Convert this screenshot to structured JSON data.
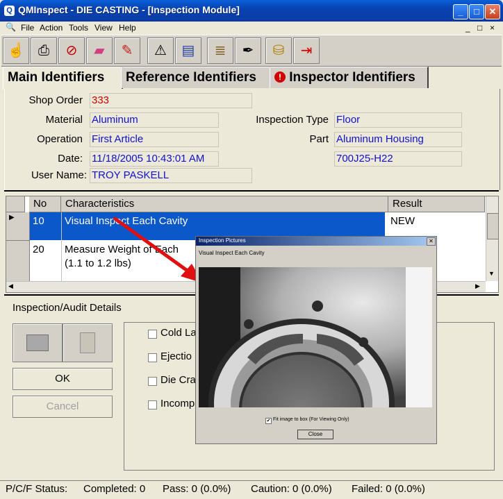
{
  "window": {
    "title": "QMInspect - DIE CASTING - [Inspection Module]",
    "app_icon_glyph": "Q",
    "minimize_glyph": "_",
    "maximize_glyph": "□",
    "close_glyph": "✕"
  },
  "menu": [
    "File",
    "Action",
    "Tools",
    "View",
    "Help"
  ],
  "menu_child_controls": [
    "_",
    "□",
    "×"
  ],
  "toolbar": {
    "buttons": [
      {
        "icon": "hand-icon",
        "glyph": "☝"
      },
      {
        "icon": "printer-icon",
        "glyph": "⎙"
      },
      {
        "icon": "no-entry-icon",
        "glyph": "⊘"
      },
      {
        "icon": "eraser-icon",
        "glyph": "▰"
      },
      {
        "icon": "paint-icon",
        "glyph": "✎"
      },
      {
        "icon": "compass-icon",
        "glyph": "⚠"
      },
      {
        "icon": "book-icon",
        "glyph": "▤"
      },
      {
        "icon": "scroll-icon",
        "glyph": "≣"
      },
      {
        "icon": "signature-icon",
        "glyph": "✒"
      },
      {
        "icon": "coins-icon",
        "glyph": "⛁"
      },
      {
        "icon": "exit-icon",
        "glyph": "⇥"
      }
    ]
  },
  "tabs": [
    {
      "label": "Main Identifiers",
      "active": true
    },
    {
      "label": "Reference Identifiers",
      "active": false
    },
    {
      "label": "Inspector Identifiers",
      "active": false,
      "icon_glyph": "!"
    }
  ],
  "identifiers": {
    "shop_order": {
      "label": "Shop Order",
      "value": "333"
    },
    "material": {
      "label": "Material",
      "value": "Aluminum"
    },
    "operation": {
      "label": "Operation",
      "value": "First Article"
    },
    "date": {
      "label": "Date:",
      "value": "11/18/2005 10:43:01 AM"
    },
    "user_name": {
      "label": "User Name:",
      "value": "TROY PASKELL"
    },
    "inspection_type": {
      "label": "Inspection Type",
      "value": "Floor"
    },
    "part": {
      "label": "Part",
      "value": "Aluminum Housing"
    },
    "part_number": {
      "value": "700J25-H22"
    }
  },
  "grid": {
    "headers": [
      "No",
      "Characteristics",
      "Result"
    ],
    "rows": [
      {
        "no": "10",
        "characteristic": "Visual Inspect Each Cavity",
        "result": "NEW",
        "selected": true
      },
      {
        "no": "20",
        "characteristic_line1": "Measure Weight of Each",
        "characteristic_line2": "(1.1 to 1.2 lbs)",
        "result": ""
      }
    ]
  },
  "details": {
    "title": "Inspection/Audit Details",
    "ok_label": "OK",
    "cancel_label": "Cancel",
    "checks": [
      "Cold La",
      "Ejectio",
      "Die Cra",
      "Incomp"
    ]
  },
  "status": {
    "label": "P/C/F Status:",
    "completed": "Completed: 0",
    "pass": "Pass: 0 (0.0%)",
    "caution": "Caution: 0 (0.0%)",
    "failed": "Failed: 0 (0.0%)"
  },
  "popup": {
    "title": "Inspection Pictures",
    "caption": "Visual Inspect Each Cavity",
    "fit_label": "Fit image to box (For Viewing Only)",
    "fit_checked": true,
    "check_glyph": "✔",
    "close_label": "Close",
    "close_glyph": "✕"
  },
  "colors": {
    "accent": "#0a58ca",
    "value_text": "#1010d0",
    "shop_order_text": "#d00000",
    "selected_row": "#0a58ca",
    "arrow": "#e01010"
  }
}
